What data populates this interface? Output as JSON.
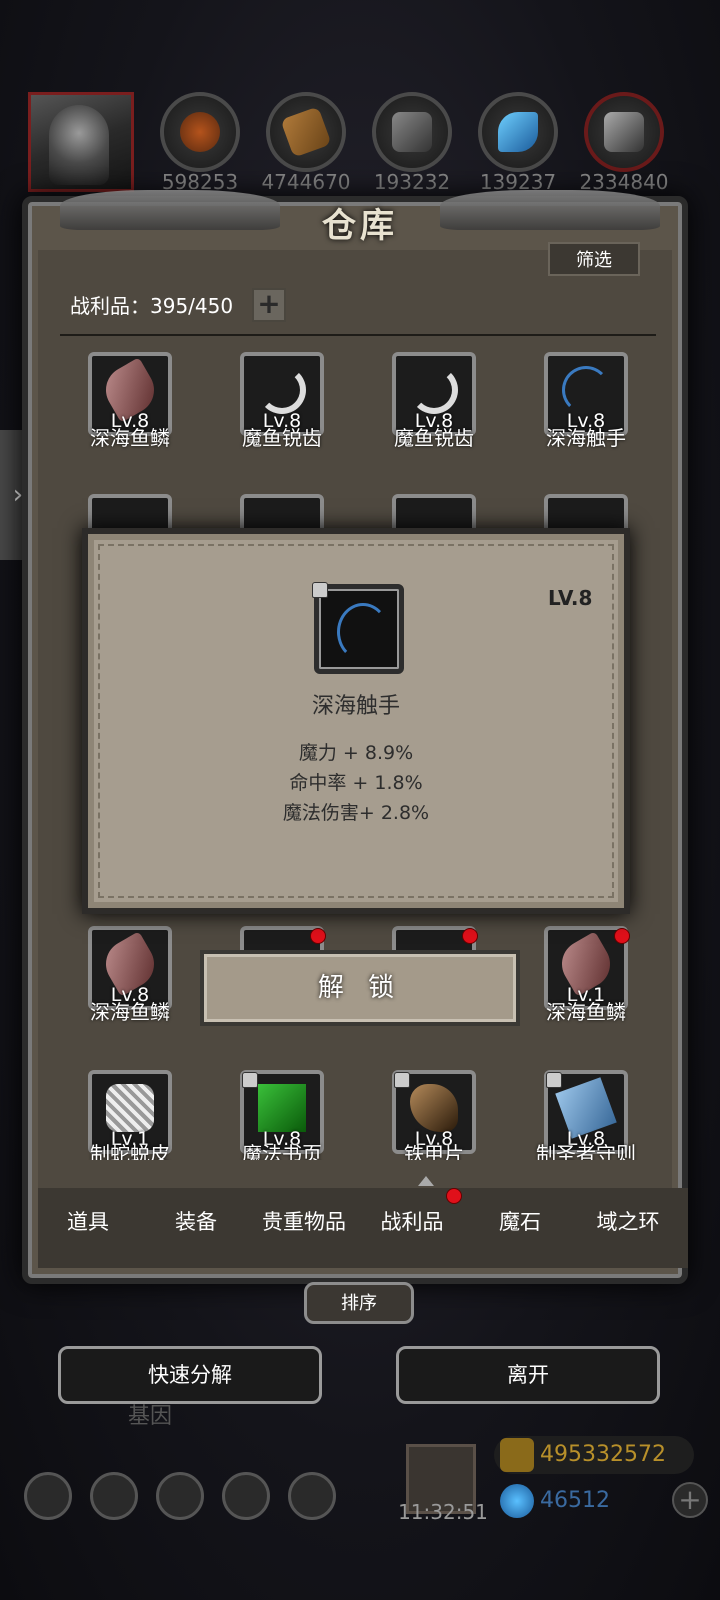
{
  "top_bar": {
    "resources": [
      {
        "icon": "leather-icon",
        "value": "598253"
      },
      {
        "icon": "wood-icon",
        "value": "4744670"
      },
      {
        "icon": "stone-icon",
        "value": "193232"
      },
      {
        "icon": "crystal-icon",
        "value": "139237"
      },
      {
        "icon": "iron-icon",
        "value": "2334840"
      }
    ]
  },
  "warehouse": {
    "title": "仓库",
    "filter_label": "筛选",
    "loot_count": "战利品：395/450",
    "plus_label": "+"
  },
  "items": {
    "row1": [
      {
        "name": "深海鱼鳞",
        "level": "Lv.8",
        "icon": "scale-icon"
      },
      {
        "name": "魔鱼锐齿",
        "level": "Lv.8",
        "icon": "fang-icon"
      },
      {
        "name": "魔鱼锐齿",
        "level": "Lv.8",
        "icon": "fang-icon"
      },
      {
        "name": "深海触手",
        "level": "Lv.8",
        "icon": "tentacle-icon"
      }
    ],
    "row3": [
      {
        "name": "深海鱼鳞",
        "level": "Lv.8",
        "icon": "scale-icon"
      },
      {
        "name": "深海鱼鳞",
        "level": "Lv.1",
        "icon": "scale-icon"
      }
    ],
    "row4": [
      {
        "name": "制蛇蜕皮",
        "level": "Lv.1",
        "icon": "snakeskin-icon"
      },
      {
        "name": "魔法书页",
        "level": "Lv.8",
        "icon": "spellbook-page-icon"
      },
      {
        "name": "铁甲片",
        "level": "Lv.8",
        "icon": "claw-icon"
      },
      {
        "name": "制圣者守则",
        "level": "Lv.8",
        "icon": "book-icon"
      }
    ]
  },
  "tooltip": {
    "level": "LV.8",
    "name": "深海触手",
    "attributes": [
      "魔力 + 8.9%",
      "命中率 + 1.8%",
      "魔法伤害+ 2.8%"
    ]
  },
  "unlock_label": "解 锁",
  "tabs": [
    "道具",
    "装备",
    "贵重物品",
    "战利品",
    "魔石",
    "域之环"
  ],
  "active_tab": "战利品",
  "sort_label": "排序",
  "quick_decompose_label": "快速分解",
  "leave_label": "离开",
  "bottom_hud": {
    "bg_text": "基因",
    "time": "11:32:51",
    "gold": "495332572",
    "gems": "46512",
    "add_label": "+"
  },
  "side_handle_label": "›"
}
